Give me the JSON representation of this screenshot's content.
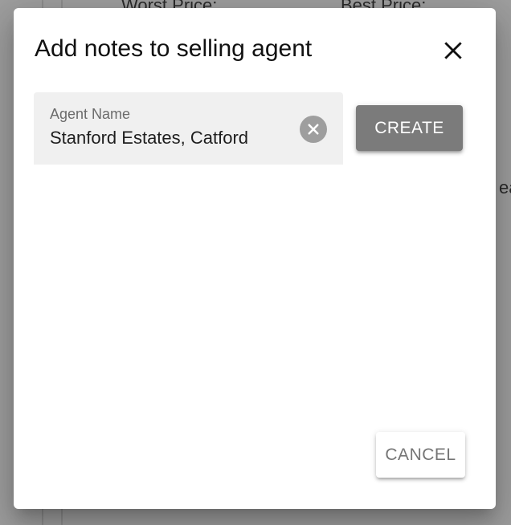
{
  "background": {
    "worst_price_label": "Worst Price:",
    "best_price_label": "Best Price:",
    "edge_text": "ea"
  },
  "dialog": {
    "title": "Add notes to selling agent",
    "close_icon": "close-icon",
    "agent_field": {
      "label": "Agent Name",
      "value": "Stanford Estates, Catford",
      "clear_icon": "clear-circle-icon"
    },
    "create_label": "CREATE",
    "cancel_label": "CANCEL"
  },
  "colors": {
    "backdrop": "#9e9e9e",
    "dialog_bg": "#ffffff",
    "field_bg": "#f0f0f0",
    "create_bg": "#7b7b7b",
    "cancel_text": "#757575"
  }
}
